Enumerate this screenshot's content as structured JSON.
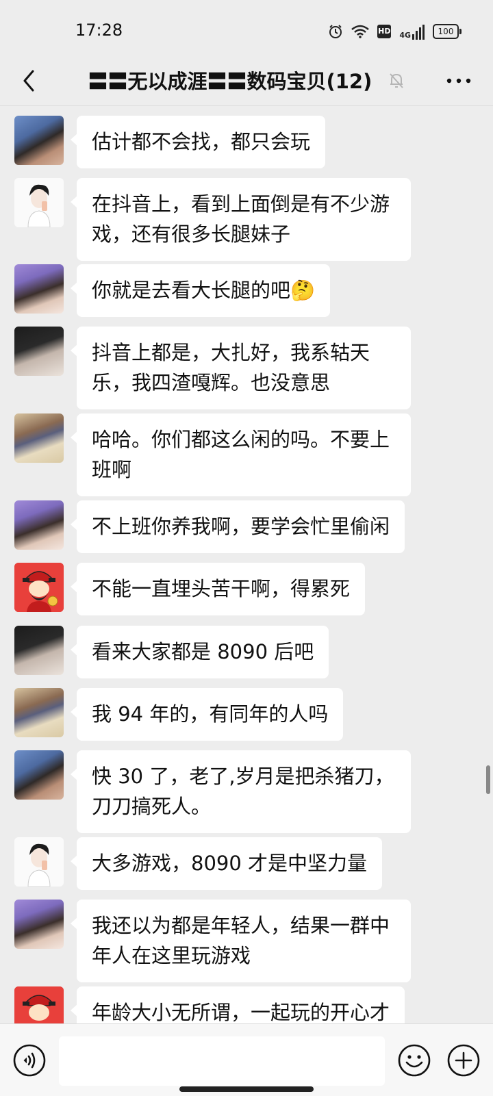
{
  "status_bar": {
    "time": "17:28",
    "battery": "100",
    "hd": "HD",
    "network": "4G"
  },
  "header": {
    "title": "〓〓无以成涯〓〓数码宝贝(12)"
  },
  "messages": [
    {
      "avatar": "avatar-boy-photo",
      "text": "估计都不会找，都只会玩"
    },
    {
      "avatar": "avatar-boy-cartoon",
      "text": "在抖音上，看到上面倒是有不少游戏，还有很多长腿妹子"
    },
    {
      "avatar": "avatar-girl-photo",
      "text": "你就是去看大长腿的吧🤔"
    },
    {
      "avatar": "avatar-anime-man",
      "text": "抖音上都是，大扎好，我系轱天乐，我四渣嘎辉。也没意思"
    },
    {
      "avatar": "avatar-feet-photo",
      "text": "哈哈。你们都这么闲的吗。不要上班啊"
    },
    {
      "avatar": "avatar-girl-photo",
      "text": "不上班你养我啊，要学会忙里偷闲"
    },
    {
      "avatar": "avatar-caishen",
      "text": "不能一直埋头苦干啊，得累死"
    },
    {
      "avatar": "avatar-anime-man",
      "text": "看来大家都是 8090 后吧"
    },
    {
      "avatar": "avatar-feet-photo",
      "text": "我 94 年的，有同年的人吗"
    },
    {
      "avatar": "avatar-boy-photo",
      "text": "快 30 了，老了,岁月是把杀猪刀，刀刀搞死人。"
    },
    {
      "avatar": "avatar-boy-cartoon",
      "text": "大多游戏，8090 才是中坚力量"
    },
    {
      "avatar": "avatar-girl-photo",
      "text": "我还以为都是年轻人，结果一群中年人在这里玩游戏"
    },
    {
      "avatar": "avatar-caishen",
      "text": "年龄大小无所谓，一起玩的开心才"
    }
  ],
  "input": {
    "value": "",
    "placeholder": ""
  },
  "icons": {
    "back": "back-arrow-icon",
    "mute": "bell-muted-icon",
    "more": "more-dots-icon",
    "voice": "voice-icon",
    "emoji": "emoji-icon",
    "plus": "plus-icon"
  }
}
